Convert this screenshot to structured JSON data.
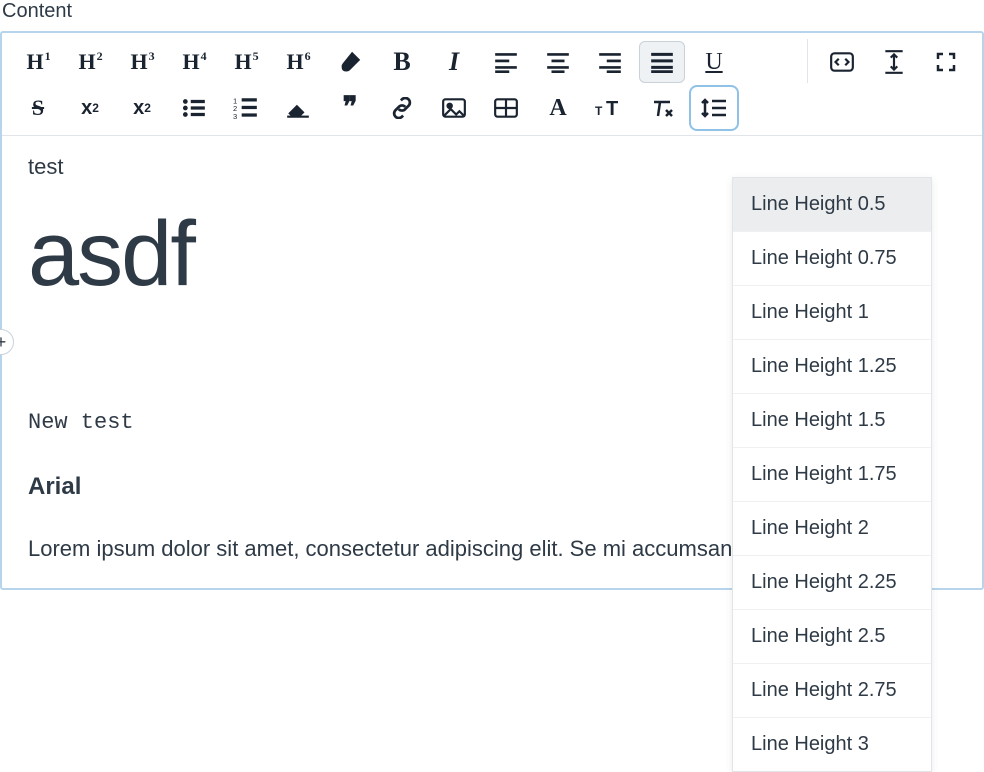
{
  "label": "Content",
  "toolbar": {
    "headings": [
      "1",
      "2",
      "3",
      "4",
      "5",
      "6"
    ]
  },
  "content": {
    "para1": "test",
    "heading": "asdf",
    "mono": "New test",
    "arial_heading": "Arial",
    "lorem": "Lorem ipsum dolor sit amet, consectetur adipiscing elit. Se               mi accumsan posuere."
  },
  "add_button": "+",
  "dropdown": {
    "items": [
      "Line Height 0.5",
      "Line Height 0.75",
      "Line Height 1",
      "Line Height 1.25",
      "Line Height 1.5",
      "Line Height 1.75",
      "Line Height 2",
      "Line Height 2.25",
      "Line Height 2.5",
      "Line Height 2.75",
      "Line Height 3"
    ]
  }
}
